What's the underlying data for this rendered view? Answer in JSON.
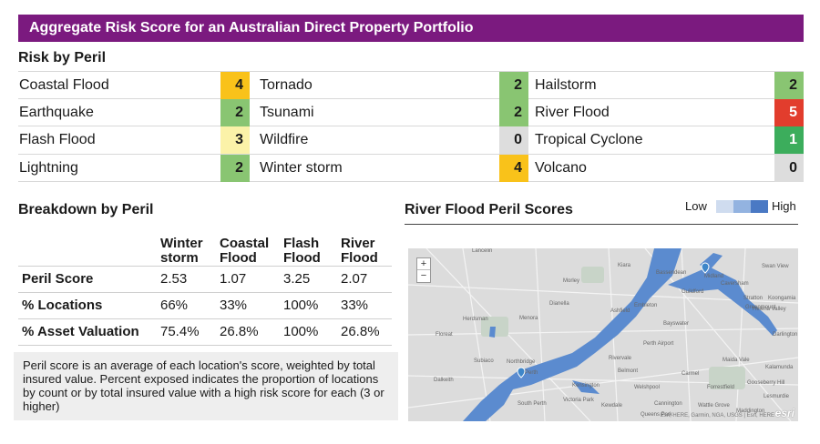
{
  "title": "Aggregate Risk Score for an Australian Direct Property Portfolio",
  "colors": {
    "title_bg": "#7b1a7f",
    "score_4": "#f9c21a",
    "score_3": "#fbf2a8",
    "score_2": "#89c572",
    "score_1": "#3cad5c",
    "score_5": "#e23d2d",
    "score_0": "#dddddd",
    "flood": "#5b8bcf"
  },
  "risk_by_peril": {
    "heading": "Risk by Peril",
    "rows": [
      [
        {
          "label": "Coastal Flood",
          "score": "4",
          "level": 4
        },
        {
          "label": "Tornado",
          "score": "2",
          "level": 2
        },
        {
          "label": "Hailstorm",
          "score": "2",
          "level": 2
        }
      ],
      [
        {
          "label": "Earthquake",
          "score": "2",
          "level": 2
        },
        {
          "label": "Tsunami",
          "score": "2",
          "level": 2
        },
        {
          "label": "River Flood",
          "score": "5",
          "level": 5
        }
      ],
      [
        {
          "label": "Flash Flood",
          "score": "3",
          "level": 3
        },
        {
          "label": "Wildfire",
          "score": "0",
          "level": 0
        },
        {
          "label": "Tropical Cyclone",
          "score": "1",
          "level": 1
        }
      ],
      [
        {
          "label": "Lightning",
          "score": "2",
          "level": 2
        },
        {
          "label": "Winter storm",
          "score": "4",
          "level": 4
        },
        {
          "label": "Volcano",
          "score": "0",
          "level": 0
        }
      ]
    ]
  },
  "breakdown": {
    "heading": "Breakdown by Peril",
    "columns": [
      {
        "line1": "Winter",
        "line2": "storm"
      },
      {
        "line1": "Coastal",
        "line2": "Flood"
      },
      {
        "line1": "Flash",
        "line2": "Flood"
      },
      {
        "line1": "River",
        "line2": "Flood"
      }
    ],
    "rows": [
      {
        "label": "Peril Score",
        "values": [
          "2.53",
          "1.07",
          "3.25",
          "2.07"
        ]
      },
      {
        "label": "% Locations",
        "values": [
          "66%",
          "33%",
          "100%",
          "33%"
        ]
      },
      {
        "label": "% Asset Valuation",
        "values": [
          "75.4%",
          "26.8%",
          "100%",
          "26.8%"
        ]
      }
    ],
    "note": "Peril score is an average of each location's score, weighted by total insured value. Percent exposed indicates the proportion of locations by count or by total insured value with a high risk score for each (3 or higher)"
  },
  "map": {
    "heading": "River Flood Peril Scores",
    "legend_low": "Low",
    "legend_high": "High",
    "legend_colors": [
      "#cfdcef",
      "#93b3e0",
      "#4a79c4"
    ],
    "zoom_in": "+",
    "zoom_out": "−",
    "attribution": "Esri, HERE, Garmin, NGA, USGS | Esri, HERE",
    "logo": "esri",
    "places": [
      "Lancelin",
      "Kiara",
      "Bassendean",
      "Guildford",
      "Caversham",
      "Midland",
      "Swan View",
      "Morley",
      "Ashfield",
      "Stratton",
      "Greenmount",
      "Koongamia",
      "Darlington",
      "Herdsman",
      "Menora",
      "Dianella",
      "Embleton",
      "Helena Valley",
      "Floreat",
      "Perth Airport",
      "Subiaco",
      "Northbridge",
      "Rivervale",
      "Maida Vale",
      "Perth",
      "Kewdale",
      "Kalamunda",
      "South Perth",
      "Victoria Park",
      "Gooseberry Hill",
      "Dalkeith",
      "Belmont",
      "Cannington",
      "Forrestfield",
      "Lesmurdie",
      "Kensington",
      "Bayswater",
      "Carmel",
      "Wattle Grove",
      "Welshpool",
      "Maddington",
      "Queens Park"
    ]
  }
}
